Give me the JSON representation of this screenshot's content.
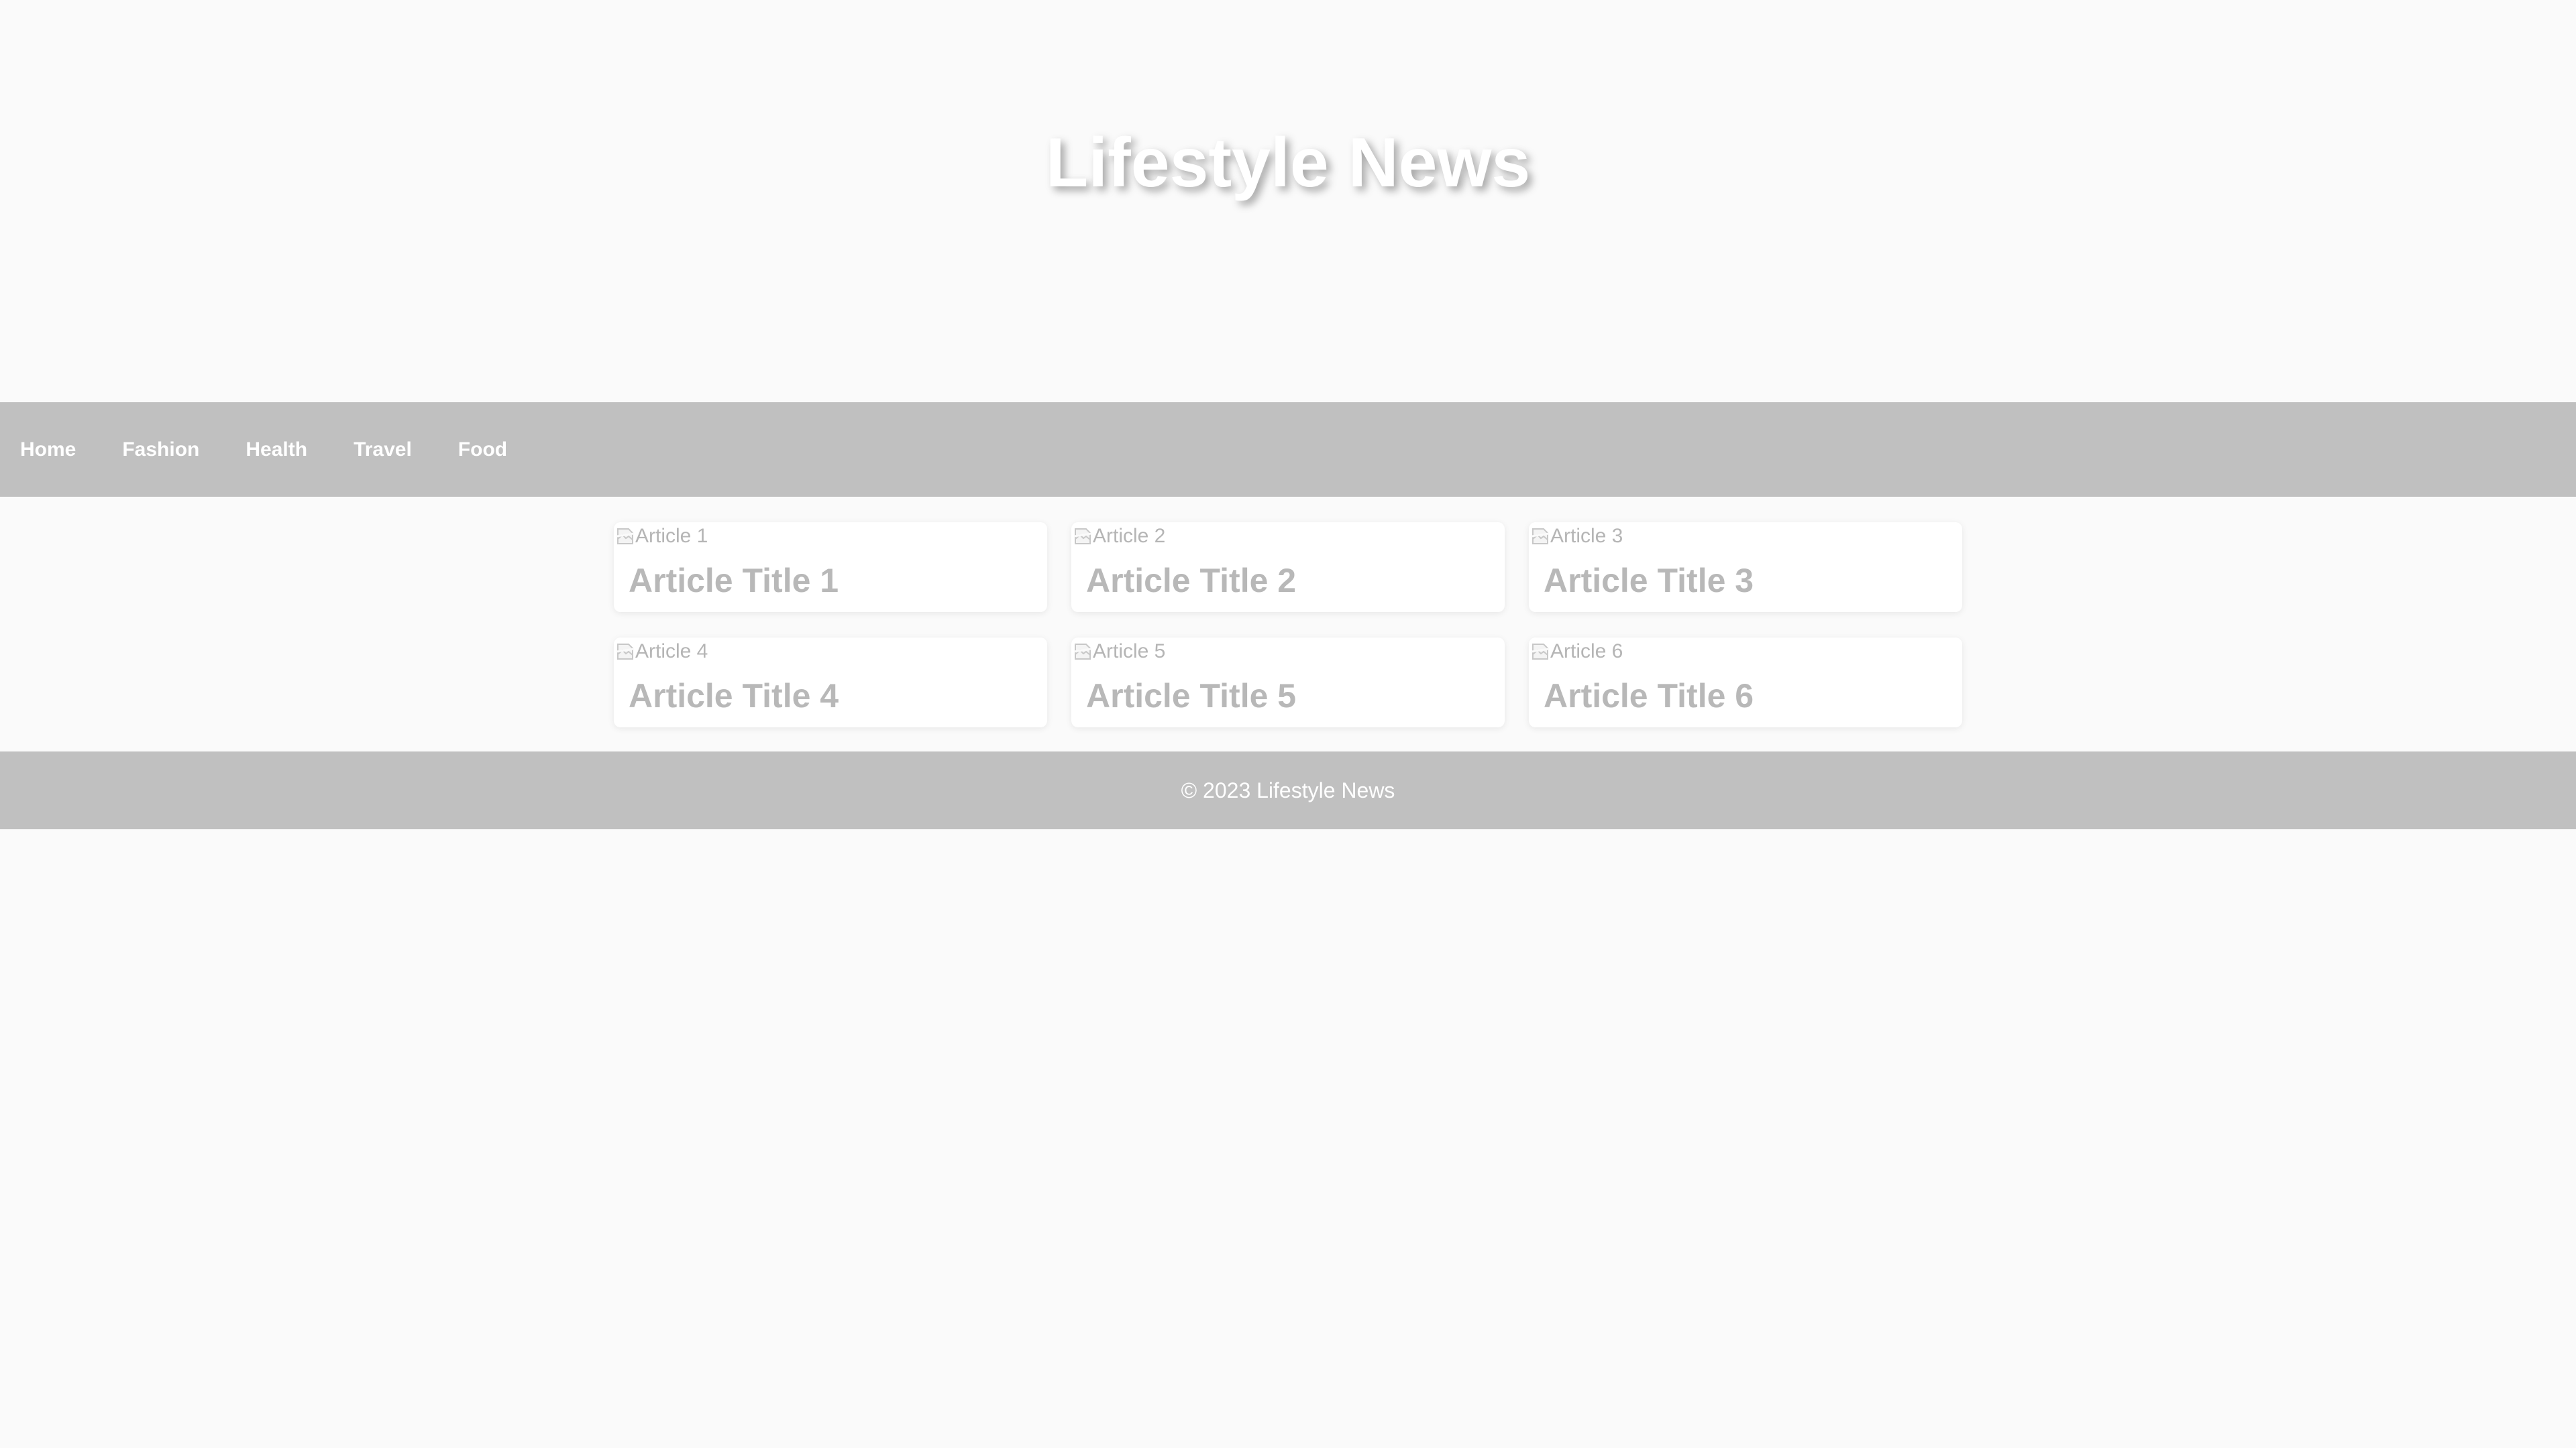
{
  "header": {
    "title": "Lifestyle News"
  },
  "nav": {
    "items": [
      {
        "label": "Home"
      },
      {
        "label": "Fashion"
      },
      {
        "label": "Health"
      },
      {
        "label": "Travel"
      },
      {
        "label": "Food"
      }
    ]
  },
  "articles": [
    {
      "image_alt": "Article 1",
      "title": "Article Title 1"
    },
    {
      "image_alt": "Article 2",
      "title": "Article Title 2"
    },
    {
      "image_alt": "Article 3",
      "title": "Article Title 3"
    },
    {
      "image_alt": "Article 4",
      "title": "Article Title 4"
    },
    {
      "image_alt": "Article 5",
      "title": "Article Title 5"
    },
    {
      "image_alt": "Article 6",
      "title": "Article Title 6"
    }
  ],
  "footer": {
    "text": "© 2023 Lifestyle News"
  },
  "colors": {
    "background": "#fafafa",
    "bar": "#c0c0c0",
    "card": "#ffffff",
    "muted_text": "#b8b8b8"
  },
  "icons": {
    "broken_image": "broken-image-icon"
  }
}
